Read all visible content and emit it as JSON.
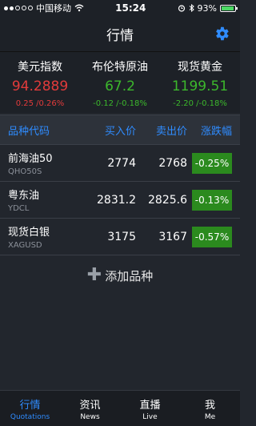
{
  "status_bar": {
    "carrier": "中国移动",
    "time": "15:24",
    "battery": "93%",
    "signal_dots_filled": 2,
    "signal_dots_total": 5,
    "battery_level": 0.93
  },
  "nav": {
    "title": "行情",
    "settings_icon": "gear-icon"
  },
  "indices": [
    {
      "name": "美元指数",
      "value": "94.2889",
      "change": "0.25 /0.26%",
      "color": "#e23b3b"
    },
    {
      "name": "布伦特原油",
      "value": "67.2",
      "change": "-0.12 /-0.18%",
      "color": "#3cb82c"
    },
    {
      "name": "现货黄金",
      "value": "1199.51",
      "change": "-2.20 /-0.18%",
      "color": "#3cb82c"
    }
  ],
  "table": {
    "headers": {
      "name": "品种代码",
      "buy": "买入价",
      "sell": "卖出价",
      "change": "涨跌幅"
    },
    "rows": [
      {
        "name": "前海油50",
        "code": "QHO50S",
        "buy": "2774",
        "sell": "2768",
        "change": "-0.25%"
      },
      {
        "name": "粤东油",
        "code": "YDCL",
        "buy": "2831.2",
        "sell": "2825.6",
        "change": "-0.13%"
      },
      {
        "name": "现货白银",
        "code": "XAGUSD",
        "buy": "3175",
        "sell": "3167",
        "change": "-0.57%"
      }
    ]
  },
  "add_item": {
    "label": "添加品种"
  },
  "tabs": [
    {
      "cn": "行情",
      "en": "Quotations",
      "active": true
    },
    {
      "cn": "资讯",
      "en": "News",
      "active": false
    },
    {
      "cn": "直播",
      "en": "Live",
      "active": false
    },
    {
      "cn": "我",
      "en": "Me",
      "active": false
    }
  ],
  "colors": {
    "accent": "#2f8cff",
    "up": "#e23b3b",
    "down": "#3cb82c",
    "badge": "#2b8a1e"
  }
}
